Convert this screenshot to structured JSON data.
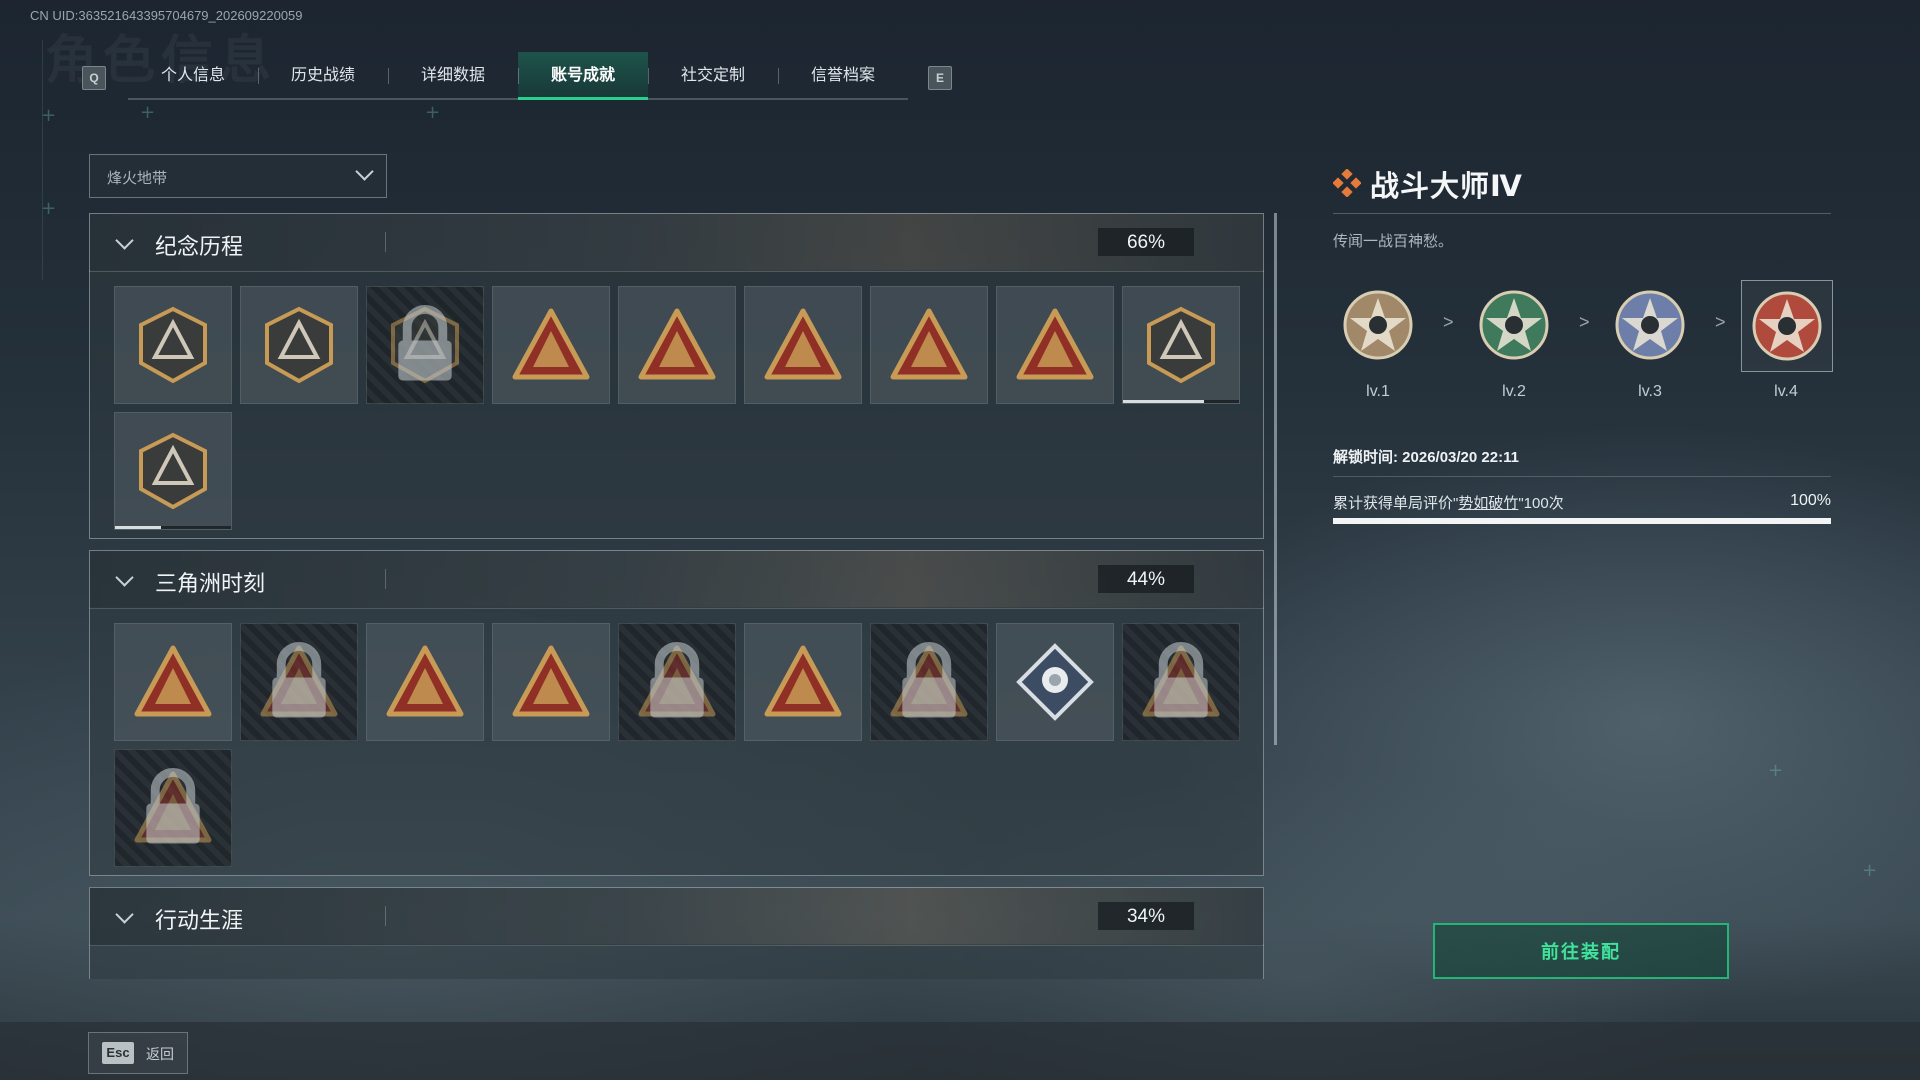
{
  "uid_text": "CN UID:3635216433957046​79_202609220059",
  "watermark": "角色信息",
  "tabs": {
    "key_left": "Q",
    "key_right": "E",
    "items": [
      "个人信息",
      "历史战绩",
      "详细数据",
      "账号成就",
      "社交定制",
      "信誉档案"
    ],
    "active_index": 3
  },
  "filter": {
    "selected": "烽火地带"
  },
  "categories": [
    {
      "title": "纪念历程",
      "progress": "66%",
      "badges": [
        {
          "icon": "delta-emblem-icon",
          "locked": false
        },
        {
          "icon": "helicopter-badge-icon",
          "locked": false
        },
        {
          "icon": "dark-shield-badge-icon",
          "locked": true
        },
        {
          "icon": "s8-train-badge-icon",
          "locked": false
        },
        {
          "icon": "s9-aircraft-badge-icon",
          "locked": false
        },
        {
          "icon": "laurel-triangle-badge-icon",
          "locked": false
        },
        {
          "icon": "number-1-badge-icon",
          "locked": false
        },
        {
          "icon": "number-2-badge-icon",
          "locked": false
        },
        {
          "icon": "delta-force-crest-badge-icon",
          "locked": false,
          "progress": 0.7
        },
        {
          "icon": "delta-force-2026-badge-icon",
          "locked": false,
          "progress": 0.4
        }
      ]
    },
    {
      "title": "三角洲时刻",
      "progress": "44%",
      "badges": [
        {
          "icon": "robot-triangle-badge-icon",
          "locked": false
        },
        {
          "icon": "soldier-triangle-badge-icon",
          "locked": true
        },
        {
          "icon": "diamond-triangle-badge-icon",
          "locked": false
        },
        {
          "icon": "team-triangle-badge-icon",
          "locked": false
        },
        {
          "icon": "hero-triangle-badge-icon",
          "locked": true
        },
        {
          "icon": "rocket-triangle-badge-icon",
          "locked": false
        },
        {
          "icon": "dragon-triangle-badge-icon",
          "locked": true
        },
        {
          "icon": "rose-diamond-badge-icon",
          "locked": false
        },
        {
          "icon": "eagle-triangle-badge-icon",
          "locked": true
        },
        {
          "icon": "skull-triangle-badge-icon",
          "locked": true
        }
      ]
    },
    {
      "title": "行动生涯",
      "progress": "34%",
      "badges": []
    }
  ],
  "detail": {
    "title": "战斗大师Ⅳ",
    "description": "传闻一战百神愁。",
    "levels": [
      {
        "label": "lv.1",
        "color": "#a08868"
      },
      {
        "label": "lv.2",
        "color": "#3f7a5c"
      },
      {
        "label": "lv.3",
        "color": "#6d7fa8"
      },
      {
        "label": "lv.4",
        "color": "#b04a3c"
      }
    ],
    "selected_level": 3,
    "arrow": ">",
    "unlock_time": "解锁时间: 2026/03/20 22:11",
    "requirement_prefix": "累计获得单局评价\"",
    "requirement_key": "势如破竹",
    "requirement_suffix": "\"100次",
    "requirement_progress": "100%",
    "progress_value": 1.0,
    "equip_button": "前往装配"
  },
  "footer": {
    "esc_key": "Esc",
    "back_label": "返回"
  },
  "colors": {
    "accent": "#2bd08e",
    "badge_gold": "#c79a55",
    "badge_red": "#8f2f26"
  }
}
